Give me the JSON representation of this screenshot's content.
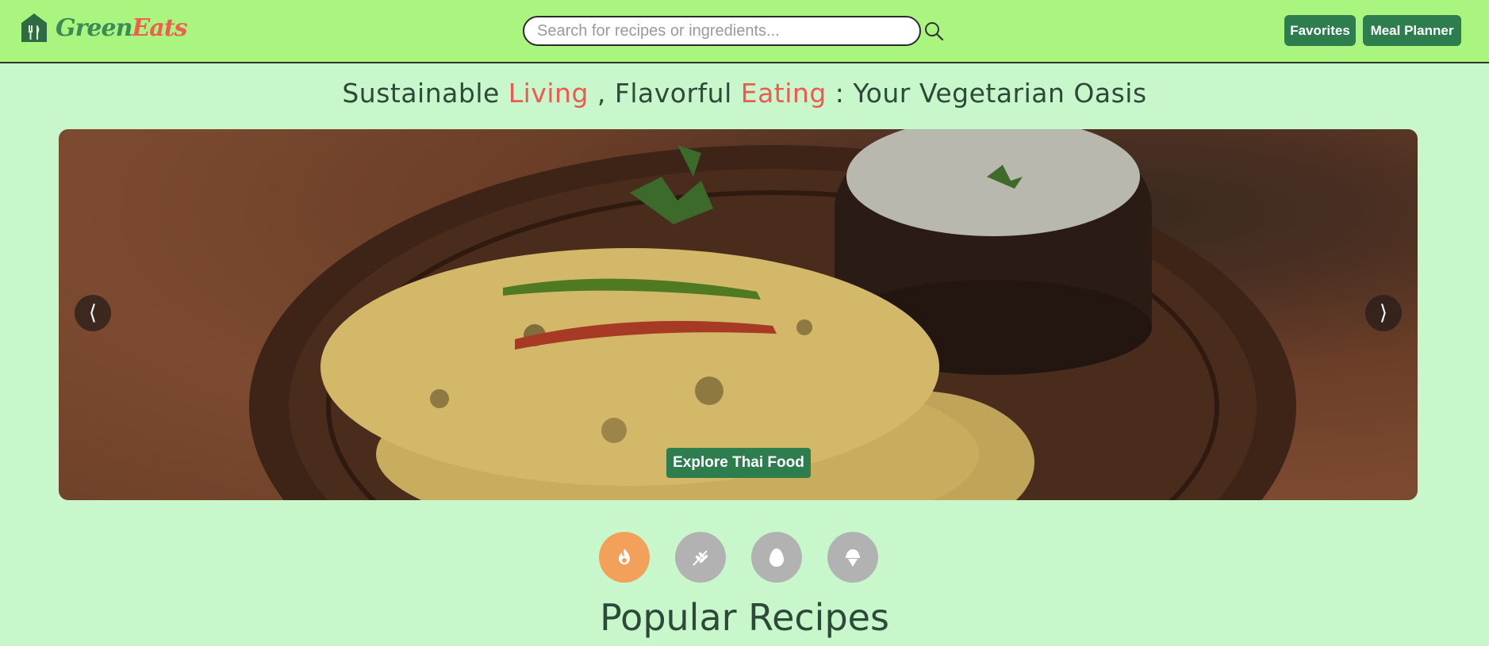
{
  "header": {
    "logo": {
      "icon": "home-fork-icon",
      "text_part1": "Green",
      "text_part2": "Eats"
    },
    "search": {
      "placeholder": "Search for recipes or ingredients...",
      "value": "",
      "icon": "search-icon"
    },
    "buttons": {
      "favorites": "Favorites",
      "meal_planner": "Meal Planner"
    }
  },
  "tagline": {
    "part1": "Sustainable ",
    "accent1": "Living",
    "part2": " , Flavorful ",
    "accent2": "Eating",
    "part3": " : Your Vegetarian Oasis"
  },
  "carousel": {
    "prev_label": "⟨",
    "next_label": "⟩",
    "cta": "Explore Thai Food"
  },
  "categories": [
    {
      "icon": "fire-icon",
      "active": true
    },
    {
      "icon": "wheat-icon",
      "active": false
    },
    {
      "icon": "egg-icon",
      "active": false
    },
    {
      "icon": "ice-cream-icon",
      "active": false
    }
  ],
  "main": {
    "section_title": "Popular Recipes"
  },
  "colors": {
    "header_bg": "#a9f580",
    "page_bg": "#c8f7cc",
    "primary_button": "#2e7d4f",
    "accent_red": "#ee5a4f",
    "active_category": "#f2a05a",
    "inactive_category": "#b2b2b2"
  }
}
